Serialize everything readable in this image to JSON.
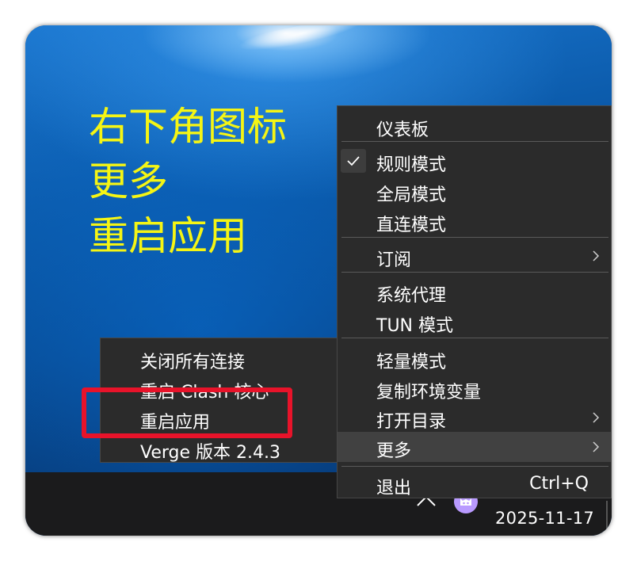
{
  "caption": {
    "lines": [
      "右下角图标",
      "更多",
      "重启应用"
    ]
  },
  "tray_menu": {
    "items": [
      {
        "label": "仪表板"
      },
      {
        "label": "规则模式",
        "checked": true
      },
      {
        "label": "全局模式"
      },
      {
        "label": "直连模式"
      },
      {
        "label": "订阅",
        "has_submenu": true
      },
      {
        "label": "系统代理"
      },
      {
        "label": "TUN 模式"
      },
      {
        "label": "轻量模式"
      },
      {
        "label": "复制环境变量"
      },
      {
        "label": "打开目录",
        "has_submenu": true
      },
      {
        "label": "更多",
        "has_submenu": true,
        "highlighted": true
      },
      {
        "label": "退出",
        "shortcut": "Ctrl+Q"
      }
    ]
  },
  "more_submenu": {
    "items": [
      {
        "label": "关闭所有连接"
      },
      {
        "label": "重启 Clash 核心"
      },
      {
        "label": "重启应用",
        "annotated": true
      },
      {
        "label": "Verge 版本 2.4.3"
      }
    ]
  },
  "taskbar": {
    "date": "2025-11-17",
    "tray_icons": [
      "chevron-up-icon",
      "clash-verge-cat-icon"
    ]
  },
  "colors": {
    "caption": "#f5f514",
    "menu_bg": "#2b2b2b",
    "highlight": "#414141",
    "annotation_box": "#e8132a",
    "tray_app": "#b99aff"
  }
}
